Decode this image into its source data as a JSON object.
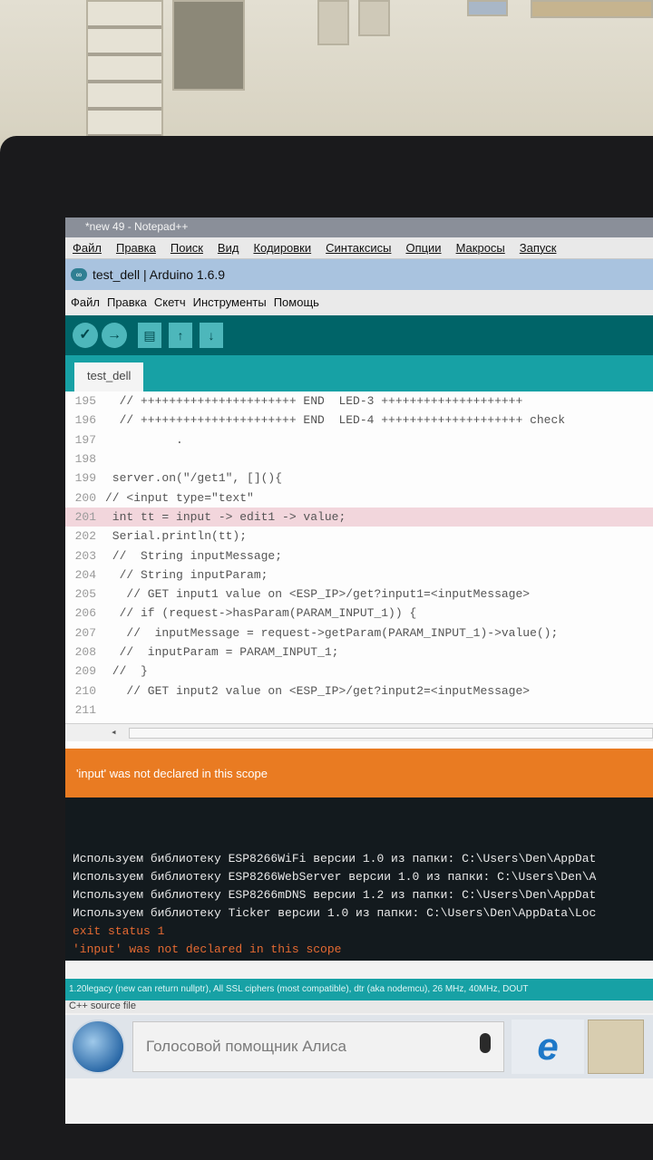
{
  "notepad": {
    "title": "*new 49 - Notepad++",
    "menu": [
      "Файл",
      "Правка",
      "Поиск",
      "Вид",
      "Кодировки",
      "Синтаксисы",
      "Опции",
      "Макросы",
      "Запуск"
    ]
  },
  "arduino": {
    "title": "test_dell | Arduino 1.6.9",
    "menu": [
      "Файл",
      "Правка",
      "Скетч",
      "Инструменты",
      "Помощь"
    ],
    "tab": "test_dell",
    "code_lines": [
      {
        "n": "195",
        "code": "  // ++++++++++++++++++++++ END  LED-3 ++++++++++++++++++++"
      },
      {
        "n": "196",
        "code": "  // ++++++++++++++++++++++ END  LED-4 ++++++++++++++++++++ check"
      },
      {
        "n": "197",
        "code": "          ."
      },
      {
        "n": "198",
        "code": ""
      },
      {
        "n": "199",
        "code": " server.on(\"/get1\", [](){"
      },
      {
        "n": "200",
        "code": "// <input type=\"text\""
      },
      {
        "n": "201",
        "code": " int tt = input -> edit1 -> value;"
      },
      {
        "n": "202",
        "code": " Serial.println(tt);"
      },
      {
        "n": "203",
        "code": " //  String inputMessage;"
      },
      {
        "n": "204",
        "code": "  // String inputParam;"
      },
      {
        "n": "205",
        "code": "   // GET input1 value on <ESP_IP>/get?input1=<inputMessage>"
      },
      {
        "n": "206",
        "code": "  // if (request->hasParam(PARAM_INPUT_1)) {"
      },
      {
        "n": "207",
        "code": "   //  inputMessage = request->getParam(PARAM_INPUT_1)->value();"
      },
      {
        "n": "208",
        "code": "  //  inputParam = PARAM_INPUT_1;"
      },
      {
        "n": "209",
        "code": " //  }"
      },
      {
        "n": "210",
        "code": "   // GET input2 value on <ESP_IP>/get?input2=<inputMessage>"
      },
      {
        "n": "211",
        "code": ""
      }
    ],
    "highlighted_line": "201",
    "error_bar": "'input' was not declared in this scope",
    "console_lines": [
      {
        "text": "Используем библиотеку ESP8266WiFi версии 1.0 из папки: C:\\Users\\Den\\AppDat",
        "type": "w"
      },
      {
        "text": "Используем библиотеку ESP8266WebServer версии 1.0 из папки: C:\\Users\\Den\\A",
        "type": "w"
      },
      {
        "text": "Используем библиотеку ESP8266mDNS версии 1.2 из папки: C:\\Users\\Den\\AppDat",
        "type": "w"
      },
      {
        "text": "Используем библиотеку Ticker версии 1.0 из папки: C:\\Users\\Den\\AppData\\Loc",
        "type": "w"
      },
      {
        "text": "exit status 1",
        "type": "e"
      },
      {
        "text": "'input' was not declared in this scope",
        "type": "e"
      }
    ],
    "status": "1.20legacy (new can return nullptr), All SSL ciphers (most compatible), dtr (aka nodemcu), 26 MHz, 40MHz, DOUT",
    "status2": "C++ source file"
  },
  "taskbar": {
    "search_placeholder": "Голосовой помощник Алиса",
    "ie_icon": "e"
  }
}
